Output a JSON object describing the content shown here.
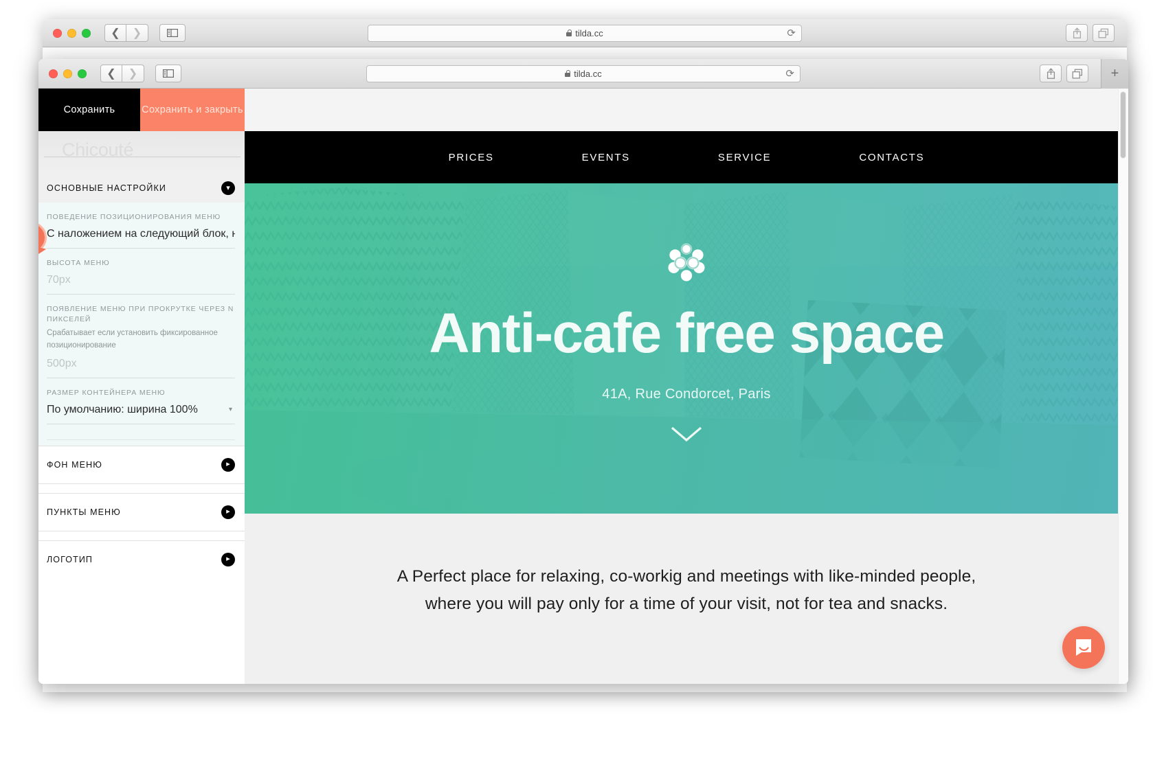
{
  "browser": {
    "back_window": {
      "url": "tilda.cc",
      "lock_icon": "lock-icon",
      "reload_icon": "reload-icon",
      "share_icon": "share-icon",
      "tabs_icon": "tabs-overview-icon",
      "back_icon": "chevron-left-icon",
      "forward_icon": "chevron-right-icon",
      "sidebar_icon": "sidebar-toggle-icon"
    },
    "front_window": {
      "url": "tilda.cc",
      "lock_icon": "lock-icon",
      "reload_icon": "reload-icon",
      "share_icon": "share-icon",
      "tabs_icon": "tabs-overview-icon",
      "new_tab_label": "+",
      "back_icon": "chevron-left-icon",
      "forward_icon": "chevron-right-icon",
      "sidebar_icon": "sidebar-toggle-icon"
    }
  },
  "editor": {
    "save_label": "Сохранить",
    "save_and_close_label": "Сохранить и закрыть",
    "project_logo_text": "Chicouté",
    "section_header": {
      "label": "ОСНОВНЫЕ НАСТРОЙКИ",
      "icon": "chevron-down-circle-icon"
    },
    "fields": [
      {
        "caption": "ПОВЕДЕНИЕ ПОЗИЦИОНИРОВАНИЯ МЕНЮ",
        "value": "С наложением на следующий блок, но б",
        "is_placeholder": false,
        "type": "select-text"
      },
      {
        "caption": "ВЫСОТА МЕНЮ",
        "value": "70px",
        "is_placeholder": true,
        "type": "text"
      },
      {
        "caption": "ПОЯВЛЕНИЕ МЕНЮ ПРИ ПРОКРУТКЕ ЧЕРЕЗ N ПИКСЕЛЕЙ",
        "hint": "Срабатывает если установить фиксированное позиционирование",
        "value": "500px",
        "is_placeholder": true,
        "type": "text"
      },
      {
        "caption": "РАЗМЕР КОНТЕЙНЕРА МЕНЮ",
        "value": "По умолчанию: ширина 100%",
        "is_placeholder": false,
        "type": "dropdown",
        "caret_icon": "chevron-down-icon"
      }
    ],
    "collapsed_sections": [
      {
        "label": "ФОН МЕНЮ",
        "icon": "chevron-right-circle-icon"
      },
      {
        "label": "ПУНКТЫ МЕНЮ",
        "icon": "chevron-right-circle-icon"
      },
      {
        "label": "ЛОГОТИП",
        "icon": "chevron-right-circle-icon"
      }
    ],
    "cursor": {
      "name": "cursor-highlight",
      "color": "#f4745a"
    }
  },
  "site": {
    "nav": [
      {
        "label": "PRICES"
      },
      {
        "label": "EVENTS"
      },
      {
        "label": "SERVICE"
      },
      {
        "label": "CONTACTS"
      }
    ],
    "hero": {
      "logo_icon": "flower-logo-icon",
      "title": "Anti-cafe free space",
      "subtitle": "41A, Rue Condorcet, Paris",
      "scroll_icon": "chevron-down-icon",
      "gradient_from": "#3fbf92",
      "gradient_to": "#4fb2b9"
    },
    "about": {
      "line1": "A Perfect place for relaxing, co-workig and meetings with like-minded people,",
      "line2": "where you will pay only for a time of your visit, not for tea and snacks."
    },
    "intercom": {
      "icon": "chat-bubble-icon",
      "color": "#f4745a"
    }
  }
}
